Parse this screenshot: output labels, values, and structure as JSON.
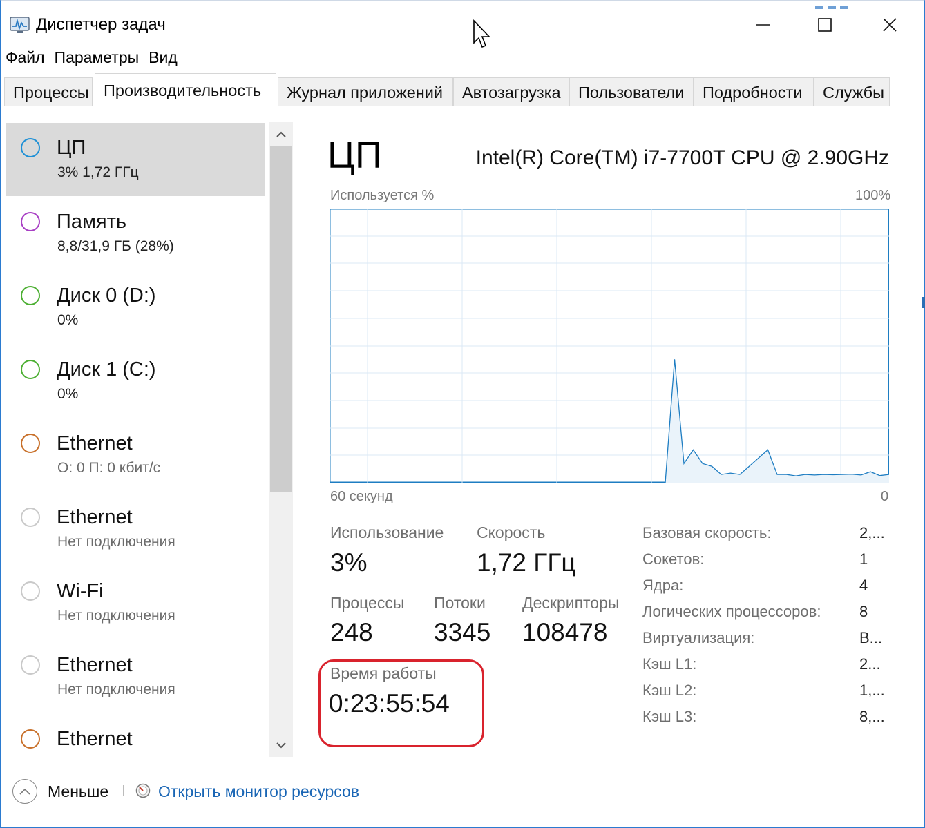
{
  "window": {
    "title": "Диспетчер задач"
  },
  "menu": [
    "Файл",
    "Параметры",
    "Вид"
  ],
  "tabs": [
    {
      "label": "Процессы"
    },
    {
      "label": "Производительность"
    },
    {
      "label": "Журнал приложений"
    },
    {
      "label": "Автозагрузка"
    },
    {
      "label": "Пользователи"
    },
    {
      "label": "Подробности"
    },
    {
      "label": "Службы"
    }
  ],
  "active_tab": "Производительность",
  "resources": [
    {
      "name": "ЦП",
      "sub": "3%  1,72 ГГц",
      "color": "#1e90d6"
    },
    {
      "name": "Память",
      "sub": "8,8/31,9 ГБ (28%)",
      "color": "#a83fc4"
    },
    {
      "name": "Диск 0 (D:)",
      "sub": "0%",
      "color": "#4caf32"
    },
    {
      "name": "Диск 1 (C:)",
      "sub": "0%",
      "color": "#4caf32"
    },
    {
      "name": "Ethernet",
      "sub": "О: 0  П: 0 кбит/с",
      "color": "#c8702a"
    },
    {
      "name": "Ethernet",
      "sub": "Нет подключения",
      "color": "#c9c9c9"
    },
    {
      "name": "Wi-Fi",
      "sub": "Нет подключения",
      "color": "#c9c9c9"
    },
    {
      "name": "Ethernet",
      "sub": "Нет подключения",
      "color": "#c9c9c9"
    },
    {
      "name": "Ethernet",
      "sub": "",
      "color": "#c8702a"
    }
  ],
  "cpu": {
    "title": "ЦП",
    "model": "Intel(R) Core(TM) i7-7700T CPU @ 2.90GHz",
    "graph_label": "Используется %",
    "graph_max": "100%",
    "axis_left": "60 секунд",
    "axis_right": "0",
    "stats": {
      "usage_label": "Использование",
      "usage_value": "3%",
      "speed_label": "Скорость",
      "speed_value": "1,72 ГГц",
      "processes_label": "Процессы",
      "processes_value": "248",
      "threads_label": "Потоки",
      "threads_value": "3345",
      "handles_label": "Дескрипторы",
      "handles_value": "108478",
      "uptime_label": "Время работы",
      "uptime_value": "0:23:55:54"
    },
    "specs": [
      {
        "label": "Базовая скорость:",
        "value": "2,..."
      },
      {
        "label": "Сокетов:",
        "value": "1"
      },
      {
        "label": "Ядра:",
        "value": "4"
      },
      {
        "label": "Логических процессоров:",
        "value": "8"
      },
      {
        "label": "Виртуализация:",
        "value": "В..."
      },
      {
        "label": "Кэш L1:",
        "value": "2..."
      },
      {
        "label": "Кэш L2:",
        "value": "1,..."
      },
      {
        "label": "Кэш L3:",
        "value": "8,..."
      }
    ]
  },
  "chart_data": {
    "type": "area",
    "x": [
      0,
      1,
      2,
      3,
      4,
      5,
      6,
      7,
      8,
      9,
      10,
      11,
      12,
      13,
      14,
      15,
      16,
      17,
      18,
      19,
      20,
      21,
      22,
      23,
      24,
      25,
      26,
      27,
      28,
      29,
      30,
      31,
      32,
      33,
      34,
      35,
      36,
      37,
      38,
      39,
      40,
      41,
      42,
      43,
      44,
      45,
      46,
      47,
      48,
      49,
      50,
      51,
      52,
      53,
      54,
      55,
      56,
      57,
      58,
      59,
      60
    ],
    "values": [
      0,
      0,
      0,
      0,
      0,
      0,
      0,
      0,
      0,
      0,
      0,
      0,
      0,
      0,
      0,
      0,
      0,
      0,
      0,
      0,
      0,
      0,
      0,
      0,
      0,
      0,
      0,
      0,
      0,
      0,
      0,
      0,
      0,
      0,
      0,
      0,
      0,
      45,
      7,
      12,
      7,
      6,
      3,
      3.5,
      3,
      6,
      9,
      12,
      3,
      3,
      2.5,
      3,
      2.8,
      3,
      2.9,
      3,
      3.1,
      2.8,
      4,
      2.6,
      3
    ],
    "ylim": [
      0,
      100
    ],
    "xlabel": "60 секунд",
    "ylabel": "Используется %",
    "grid": true,
    "line_color": "#1e7dc2",
    "fill_color": "#eaf3fa"
  },
  "footer": {
    "less_label": "Меньше",
    "monitor_label": "Открыть монитор ресурсов"
  },
  "colors": {
    "accent": "#1a66b5",
    "highlight_border": "#d9232d"
  }
}
